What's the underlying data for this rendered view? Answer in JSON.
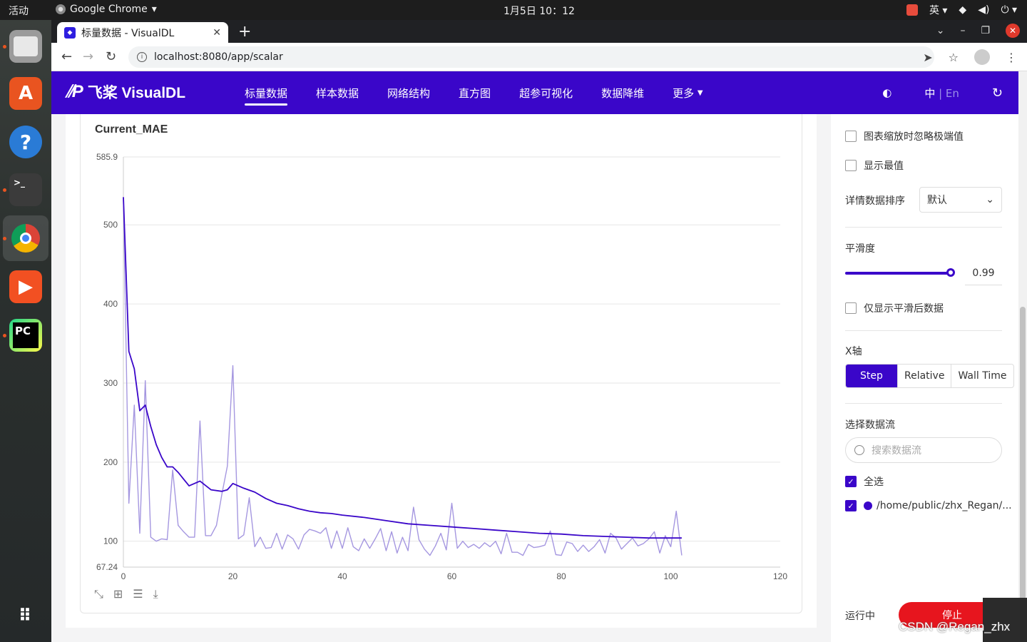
{
  "system": {
    "activities": "活动",
    "app_name": "Google Chrome",
    "clock": "1月5日  10：12",
    "input_method": "英"
  },
  "browser": {
    "tab_title": "标量数据 - VisualDL",
    "url": "localhost:8080/app/scalar"
  },
  "header": {
    "logo_text": "飞桨 VisualDL",
    "nav": [
      "标量数据",
      "样本数据",
      "网络结构",
      "直方图",
      "超参可视化",
      "数据降维",
      "更多"
    ],
    "lang_zh": "中",
    "lang_sep": " | ",
    "lang_en": "En"
  },
  "chart_card": {
    "title": "Current_MAE"
  },
  "sidebar": {
    "ignore_outliers": "图表缩放时忽略极端值",
    "show_extremes": "显示最值",
    "sort_label": "详情数据排序",
    "sort_value": "默认",
    "smoothing_label": "平滑度",
    "smoothing_value": "0.99",
    "smoothing_fraction": 0.99,
    "only_smoothed": "仅显示平滑后数据",
    "xaxis_label": "X轴",
    "xaxis_options": [
      "Step",
      "Relative",
      "Wall Time"
    ],
    "xaxis_selected": "Step",
    "stream_label": "选择数据流",
    "search_placeholder": "搜索数据流",
    "select_all": "全选",
    "stream_name": "/home/public/zhx_Regan/...",
    "stream_color": "#3a06c9",
    "status": "运行中",
    "stop": "停止"
  },
  "watermark": "CSDN @Regan_zhx",
  "chart_data": {
    "type": "line",
    "title": "Current_MAE",
    "xlabel": "",
    "ylabel": "",
    "xlim": [
      0,
      120
    ],
    "ylim": [
      67.24,
      585.9
    ],
    "x_ticks": [
      0,
      20,
      40,
      60,
      80,
      100,
      120
    ],
    "y_ticks": [
      67.24,
      100,
      200,
      300,
      400,
      500,
      585.9
    ],
    "grid": true,
    "series": [
      {
        "name": "",
        "color": "#a597e0",
        "style": "raw",
        "x": [
          0,
          1,
          2,
          3,
          4,
          5,
          6,
          7,
          8,
          9,
          10,
          11,
          12,
          13,
          14,
          15,
          16,
          17,
          18,
          19,
          20,
          21,
          22,
          23,
          24,
          25,
          26,
          27,
          28,
          29,
          30,
          31,
          32,
          33,
          34,
          35,
          36,
          37,
          38,
          39,
          40,
          41,
          42,
          43,
          44,
          45,
          46,
          47,
          48,
          49,
          50,
          51,
          52,
          53,
          54,
          55,
          56,
          57,
          58,
          59,
          60,
          61,
          62,
          63,
          64,
          65,
          66,
          67,
          68,
          69,
          70,
          71,
          72,
          73,
          74,
          75,
          76,
          77,
          78,
          79,
          80,
          81,
          82,
          83,
          84,
          85,
          86,
          87,
          88,
          89,
          90,
          91,
          92,
          93,
          94,
          95,
          96,
          97,
          98,
          99,
          100,
          101,
          102
        ],
        "values": [
          535,
          148,
          272,
          110,
          303,
          105,
          100,
          103,
          102,
          190,
          120,
          112,
          105,
          105,
          252,
          107,
          107,
          120,
          160,
          195,
          322,
          103,
          108,
          155,
          93,
          105,
          91,
          92,
          110,
          90,
          108,
          103,
          90,
          108,
          115,
          113,
          110,
          117,
          91,
          113,
          91,
          117,
          93,
          88,
          103,
          91,
          103,
          116,
          88,
          112,
          85,
          105,
          88,
          143,
          102,
          90,
          82,
          94,
          110,
          89,
          148,
          91,
          100,
          92,
          96,
          91,
          98,
          93,
          100,
          84,
          110,
          86,
          86,
          82,
          96,
          92,
          93,
          95,
          113,
          83,
          82,
          99,
          97,
          87,
          95,
          87,
          93,
          102,
          85,
          110,
          104,
          90,
          97,
          104,
          94,
          97,
          103,
          112,
          85,
          107,
          93,
          138,
          82
        ]
      },
      {
        "name": "",
        "color": "#3a06c9",
        "style": "smoothed",
        "x": [
          0,
          1,
          2,
          3,
          4,
          5,
          6,
          7,
          8,
          9,
          10,
          12,
          14,
          16,
          18,
          19,
          20,
          22,
          24,
          26,
          28,
          30,
          32,
          34,
          36,
          38,
          40,
          44,
          48,
          52,
          56,
          60,
          64,
          68,
          72,
          76,
          80,
          84,
          88,
          92,
          96,
          100,
          102
        ],
        "values": [
          535,
          340,
          318,
          265,
          272,
          245,
          222,
          206,
          194,
          194,
          187,
          170,
          176,
          165,
          163,
          165,
          173,
          167,
          162,
          154,
          148,
          145,
          141,
          138,
          136,
          135,
          133,
          130,
          126,
          122,
          120,
          118,
          116,
          114,
          112,
          110,
          109,
          107,
          106,
          105,
          104,
          104,
          104
        ]
      }
    ]
  }
}
